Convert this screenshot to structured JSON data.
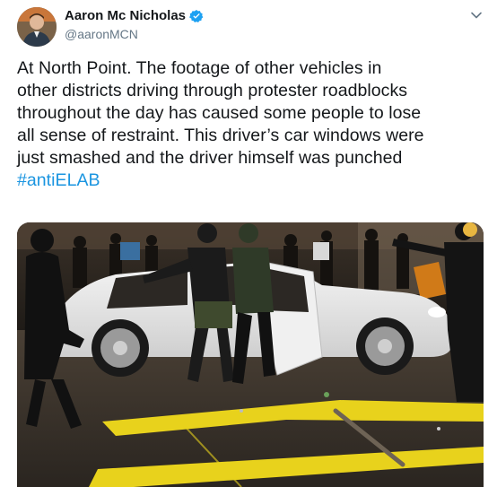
{
  "tweet": {
    "author": {
      "display_name": "Aaron Mc Nicholas",
      "handle": "@aaronMCN",
      "verified": true,
      "avatar_icon": "profile-photo"
    },
    "text_lines": [
      "At North Point. The footage of other vehicles in",
      "other districts driving through protester roadblocks",
      "throughout the day has caused some people to lose",
      "all sense of restraint. This driver’s car windows were",
      "just smashed and the driver himself was punched"
    ],
    "hashtag": "#antiELAB",
    "media": {
      "type": "video-frame",
      "icon": "photo-icon"
    },
    "menu_icon": "chevron-down-icon"
  },
  "colors": {
    "text": "#14171a",
    "secondary": "#657786",
    "link": "#1b95e0",
    "verified": "#1da1f2",
    "road_line": "#e8d21c"
  }
}
